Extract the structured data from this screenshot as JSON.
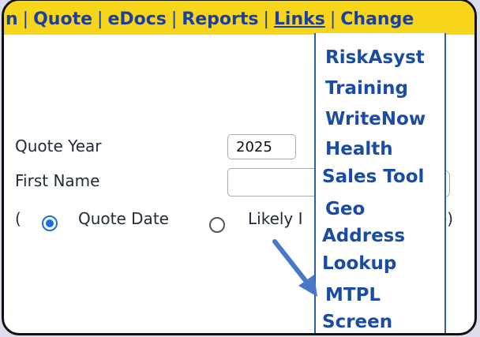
{
  "navbar": {
    "items": [
      {
        "label": "n"
      },
      {
        "label": "Quote"
      },
      {
        "label": "eDocs"
      },
      {
        "label": "Reports"
      },
      {
        "label": "Links"
      },
      {
        "label": "Change"
      }
    ],
    "separator": "|"
  },
  "form": {
    "quote_year_label": "Quote Year",
    "quote_year_value": "2025",
    "first_name_label": "First Name",
    "first_name_value": "",
    "open_paren": "(",
    "radio_quote_date_label": "Quote Date",
    "radio_likely_label": "Likely I",
    "close_text": "e)",
    "close_paren_stub": ")"
  },
  "links_menu": {
    "items": [
      {
        "label": "RiskAsyst"
      },
      {
        "label": "Training"
      },
      {
        "label": "WriteNow"
      },
      {
        "label": "Health"
      },
      {
        "label": "Sales Tool"
      },
      {
        "label": "Geo"
      },
      {
        "label": "Address"
      },
      {
        "label": "Lookup"
      },
      {
        "label": "MTPL"
      },
      {
        "label": "Screen"
      }
    ]
  },
  "colors": {
    "navbar_bg": "#f7d51a",
    "link_color": "#1a4ca3",
    "arrow_color": "#4a78c8",
    "radio_selected": "#1a6fe0"
  },
  "icons": {
    "annotation_arrow": "arrow-icon"
  }
}
